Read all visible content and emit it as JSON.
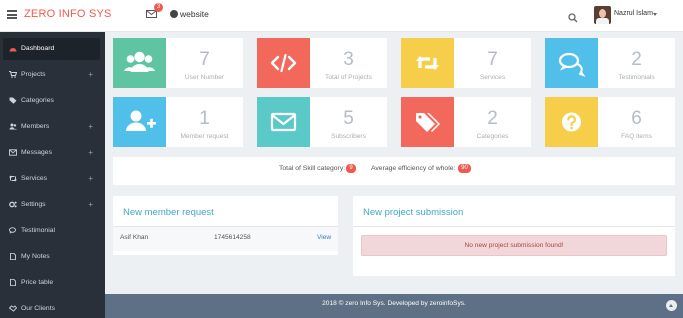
{
  "header": {
    "brand": "ZERO INFO SYS",
    "mail_badge": "3",
    "website_label": "website",
    "user_name": "Nazrul Islam"
  },
  "sidebar": {
    "items": [
      {
        "label": "Dashboard",
        "icon": "dashboard-icon",
        "active": true,
        "has_submenu": false
      },
      {
        "label": "Projects",
        "icon": "cart-icon",
        "active": false,
        "has_submenu": true
      },
      {
        "label": "Categories",
        "icon": "tag-icon",
        "active": false,
        "has_submenu": false
      },
      {
        "label": "Members",
        "icon": "users-icon",
        "active": false,
        "has_submenu": true
      },
      {
        "label": "Messages",
        "icon": "envelope-icon",
        "active": false,
        "has_submenu": true
      },
      {
        "label": "Services",
        "icon": "retweet-icon",
        "active": false,
        "has_submenu": true
      },
      {
        "label": "Settings",
        "icon": "cogs-icon",
        "active": false,
        "has_submenu": true
      },
      {
        "label": "Testimonial",
        "icon": "comments-icon",
        "active": false,
        "has_submenu": false
      },
      {
        "label": "My Notes",
        "icon": "file-icon",
        "active": false,
        "has_submenu": false
      },
      {
        "label": "Price table",
        "icon": "file-icon",
        "active": false,
        "has_submenu": false
      },
      {
        "label": "Our Clients",
        "icon": "handshake-icon",
        "active": false,
        "has_submenu": false
      }
    ],
    "plus_symbol": "+"
  },
  "stats": [
    {
      "value": "7",
      "label": "User Number",
      "icon": "users-icon",
      "color": "#5fc4a2"
    },
    {
      "value": "3",
      "label": "Total of Projects",
      "icon": "code-icon",
      "color": "#f2695c"
    },
    {
      "value": "7",
      "label": "Services",
      "icon": "retweet-icon",
      "color": "#f6ce4a"
    },
    {
      "value": "2",
      "label": "Testimonials",
      "icon": "comments-icon",
      "color": "#50bfe9"
    },
    {
      "value": "1",
      "label": "Member request",
      "icon": "user-plus-icon",
      "color": "#50bfe9"
    },
    {
      "value": "5",
      "label": "Subscribers",
      "icon": "envelope-icon",
      "color": "#5cc9c9"
    },
    {
      "value": "2",
      "label": "Categories",
      "icon": "tags-icon",
      "color": "#f2695c"
    },
    {
      "value": "6",
      "label": "FAQ items",
      "icon": "question-icon",
      "color": "#f6ce4a"
    }
  ],
  "info": {
    "skill_label": "Total of Skill category:",
    "skill_value": "9",
    "efficiency_label": "Average efficiency of whole:",
    "efficiency_value": "90"
  },
  "member_panel": {
    "title": "New member request",
    "rows": [
      {
        "name": "Asif Khan",
        "phone": "1745614258",
        "action": "View"
      }
    ]
  },
  "project_panel": {
    "title": "New project submission",
    "alert": "No new project submission found!"
  },
  "footer": {
    "text": "2018 © zero Info Sys. Developed by zeroinfoSys."
  }
}
